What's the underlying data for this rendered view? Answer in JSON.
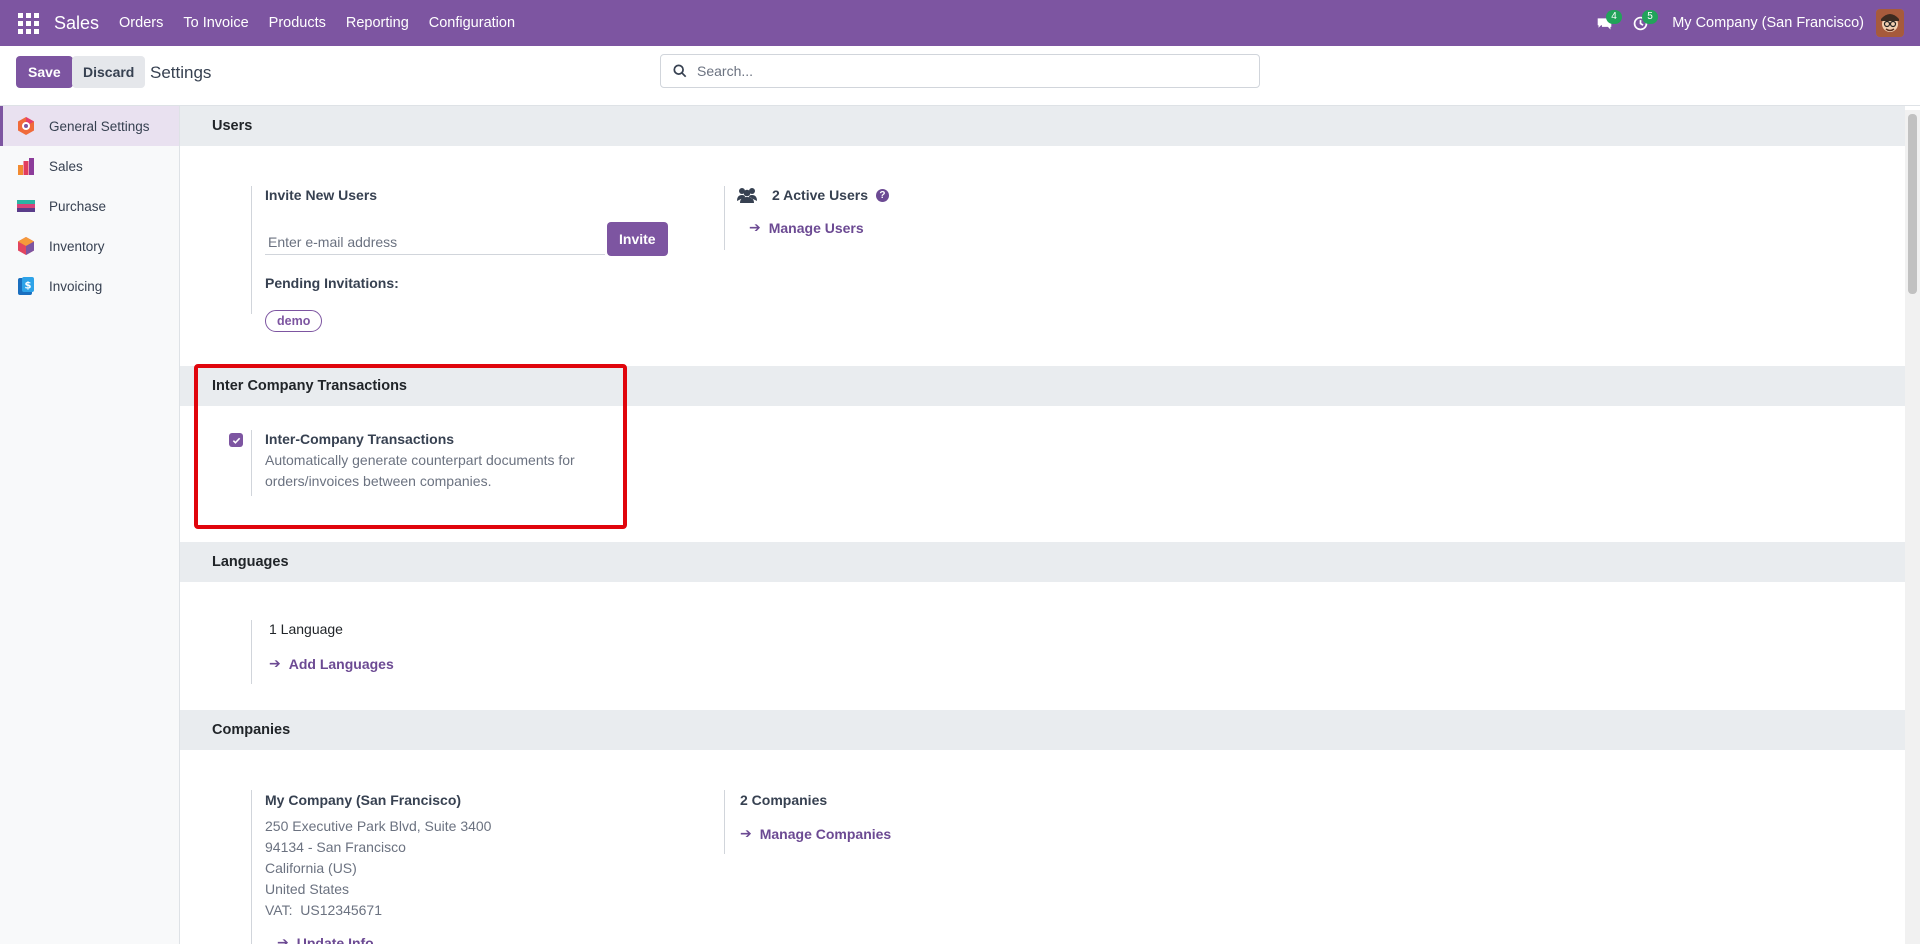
{
  "navbar": {
    "brand": "Sales",
    "menu": [
      "Orders",
      "To Invoice",
      "Products",
      "Reporting",
      "Configuration"
    ],
    "messages_count": "4",
    "activities_count": "5",
    "company": "My Company (San Francisco)"
  },
  "control_panel": {
    "save_label": "Save",
    "discard_label": "Discard",
    "title": "Settings",
    "search_placeholder": "Search..."
  },
  "sidebar": {
    "items": [
      {
        "label": "General Settings",
        "icon": "general-settings-icon"
      },
      {
        "label": "Sales",
        "icon": "sales-app-icon"
      },
      {
        "label": "Purchase",
        "icon": "purchase-app-icon"
      },
      {
        "label": "Inventory",
        "icon": "inventory-app-icon"
      },
      {
        "label": "Invoicing",
        "icon": "invoicing-app-icon"
      }
    ]
  },
  "users": {
    "header": "Users",
    "invite_title": "Invite New Users",
    "email_placeholder": "Enter e-mail address",
    "invite_label": "Invite",
    "pending_label": "Pending Invitations:",
    "pending_tags": [
      "demo"
    ],
    "active_users": "2 Active Users",
    "manage_users": "Manage Users"
  },
  "inter_company": {
    "header": "Inter Company Transactions",
    "title": "Inter-Company Transactions",
    "description_line1": "Automatically generate counterpart documents for",
    "description_line2": "orders/invoices between companies.",
    "checked": true
  },
  "languages": {
    "header": "Languages",
    "count": "1 Language",
    "add_label": "Add Languages"
  },
  "companies": {
    "header": "Companies",
    "name": "My Company (San Francisco)",
    "address": [
      "250 Executive Park Blvd, Suite 3400",
      "94134 - San Francisco",
      "California (US)",
      "United States",
      "VAT:  US12345671"
    ],
    "update_info": "Update Info",
    "count": "2 Companies",
    "manage_companies": "Manage Companies"
  },
  "colors": {
    "brand": "#7d55a1",
    "highlight": "#e0050c",
    "badge": "#22a35a"
  }
}
